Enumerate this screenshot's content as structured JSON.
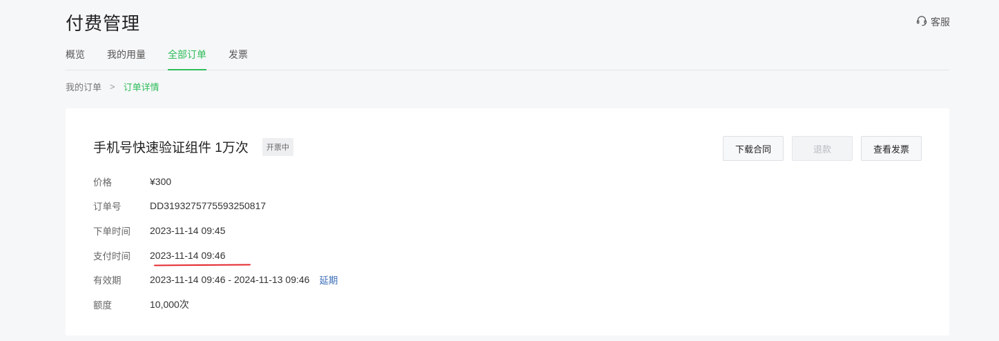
{
  "header": {
    "title": "付费管理",
    "support_label": "客服"
  },
  "tabs": [
    {
      "label": "概览",
      "active": false
    },
    {
      "label": "我的用量",
      "active": false
    },
    {
      "label": "全部订单",
      "active": true
    },
    {
      "label": "发票",
      "active": false
    }
  ],
  "breadcrumb": {
    "parent": "我的订单",
    "separator": ">",
    "current": "订单详情"
  },
  "order": {
    "product_name": "手机号快速验证组件 1万次",
    "status": "开票中",
    "actions": {
      "download_contract": "下载合同",
      "refund": "退款",
      "view_invoice": "查看发票"
    },
    "fields": {
      "price": {
        "label": "价格",
        "value": "¥300"
      },
      "order_no": {
        "label": "订单号",
        "value": "DD3193275775593250817"
      },
      "order_time": {
        "label": "下单时间",
        "value": "2023-11-14 09:45"
      },
      "pay_time": {
        "label": "支付时间",
        "value": "2023-11-14 09:46"
      },
      "validity": {
        "label": "有效期",
        "value": "2023-11-14 09:46 - 2024-11-13 09:46",
        "extend_label": "延期"
      },
      "quota": {
        "label": "额度",
        "value": "10,000次"
      }
    }
  },
  "colors": {
    "accent": "#2ebd59",
    "link": "#3c6db8",
    "annotation": "#e3262c"
  },
  "icons": {
    "support": "headset-icon"
  }
}
